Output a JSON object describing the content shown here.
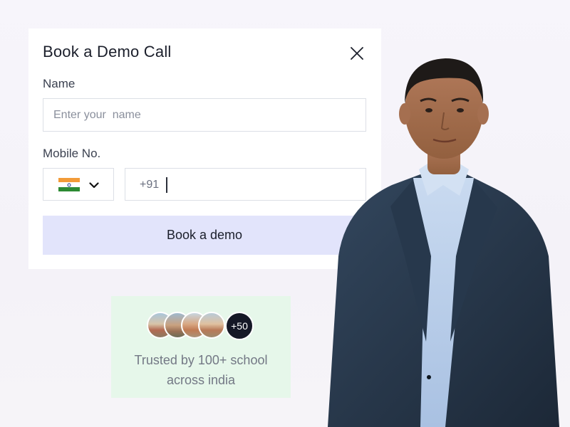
{
  "modal": {
    "title": "Book a Demo Call",
    "name_label": "Name",
    "name_placeholder": "Enter your  name",
    "name_value": "",
    "mobile_label": "Mobile No.",
    "country_flag": "india-flag-icon",
    "dial_code": "+91",
    "phone_value": "",
    "submit_label": "Book a demo",
    "icons": {
      "close": "close-icon",
      "dropdown": "chevron-down-icon"
    }
  },
  "trust": {
    "more_count": "+50",
    "line1": "Trusted by 100+ school",
    "line2": "across india"
  },
  "colors": {
    "submit_bg": "#e2e4fb",
    "trust_bg": "#e6f7ea",
    "badge_bg": "#151826",
    "page_bg": "#f5f3f9"
  }
}
